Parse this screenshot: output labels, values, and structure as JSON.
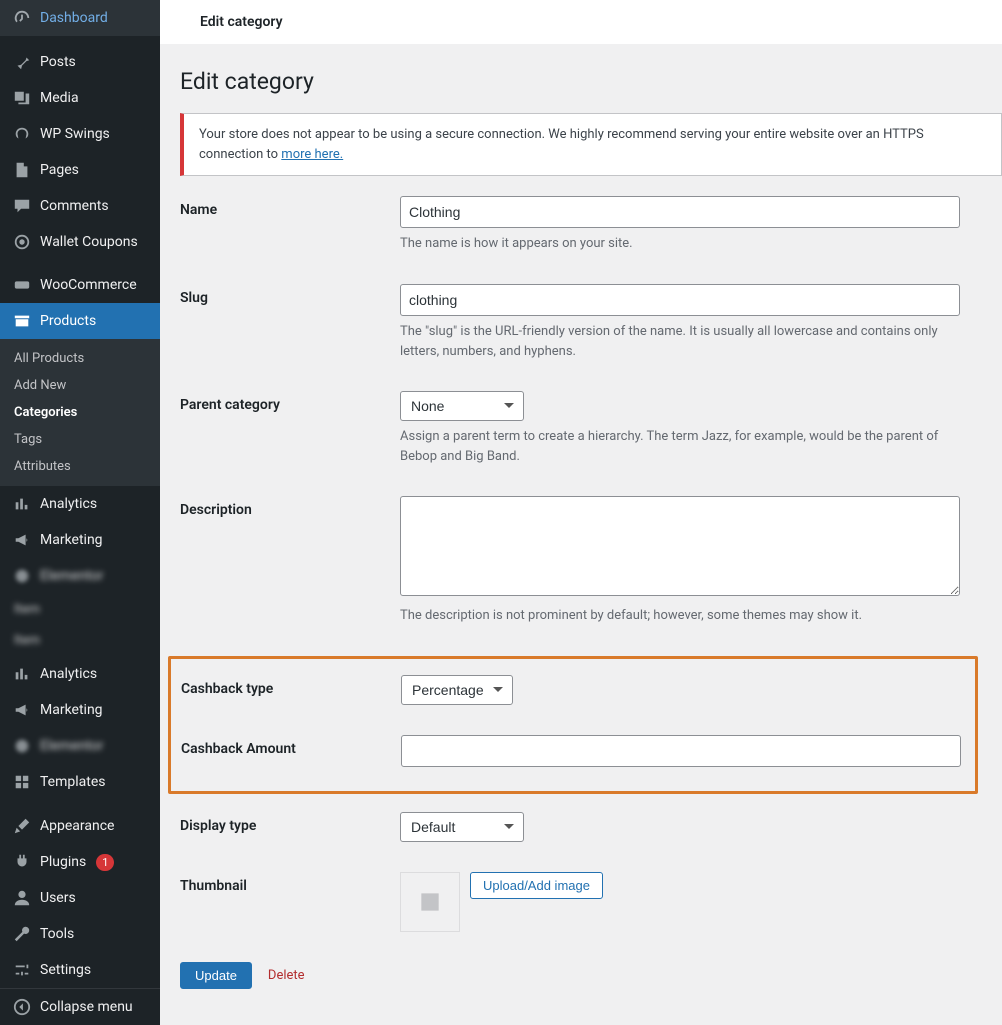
{
  "topbar": {
    "title": "Edit category"
  },
  "page": {
    "heading": "Edit category"
  },
  "notice": {
    "text": "Your store does not appear to be using a secure connection. We highly recommend serving your entire website over an HTTPS connection to",
    "link": "more here."
  },
  "sidebar": {
    "dashboard": "Dashboard",
    "posts": "Posts",
    "media": "Media",
    "wpswings": "WP Swings",
    "pages": "Pages",
    "comments": "Comments",
    "wallet_coupons": "Wallet Coupons",
    "woocommerce": "WooCommerce",
    "products": "Products",
    "analytics": "Analytics",
    "marketing": "Marketing",
    "hidden1": "Elementor",
    "hidden1a": "Item",
    "hidden1b": "Item",
    "templates": "Templates",
    "appearance": "Appearance",
    "plugins": "Plugins",
    "plugins_count": "1",
    "users": "Users",
    "tools": "Tools",
    "settings": "Settings",
    "collapse": "Collapse menu"
  },
  "submenu": {
    "all_products": "All Products",
    "add_new": "Add New",
    "categories": "Categories",
    "tags": "Tags",
    "attributes": "Attributes"
  },
  "form": {
    "name_label": "Name",
    "name_value": "Clothing",
    "name_help": "The name is how it appears on your site.",
    "slug_label": "Slug",
    "slug_value": "clothing",
    "slug_help": "The \"slug\" is the URL-friendly version of the name. It is usually all lowercase and contains only letters, numbers, and hyphens.",
    "parent_label": "Parent category",
    "parent_value": "None",
    "parent_help": "Assign a parent term to create a hierarchy. The term Jazz, for example, would be the parent of Bebop and Big Band.",
    "desc_label": "Description",
    "desc_value": "",
    "desc_help": "The description is not prominent by default; however, some themes may show it.",
    "cashback_type_label": "Cashback type",
    "cashback_type_value": "Percentage",
    "cashback_amount_label": "Cashback Amount",
    "cashback_amount_value": "",
    "display_type_label": "Display type",
    "display_type_value": "Default",
    "thumb_label": "Thumbnail",
    "upload_btn": "Upload/Add image",
    "update_btn": "Update",
    "delete_link": "Delete"
  }
}
